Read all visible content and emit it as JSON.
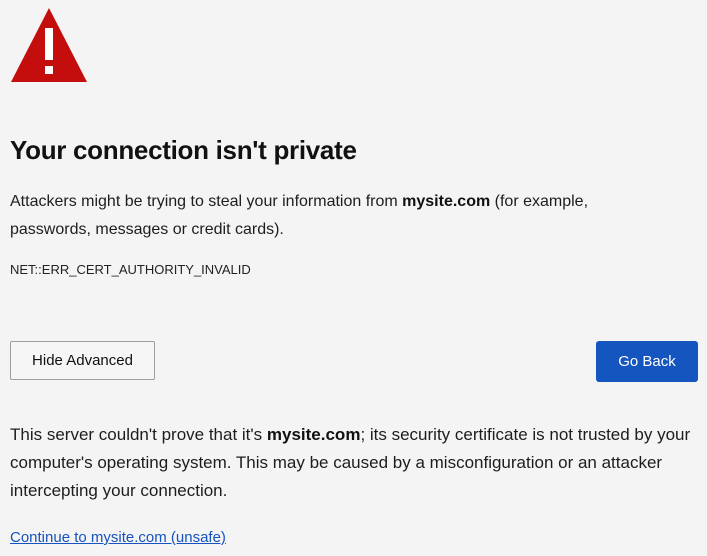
{
  "header": {
    "title": "Your connection isn't private"
  },
  "intro": {
    "before": "Attackers might be trying to steal your information from ",
    "site": "mysite.com",
    "after": " (for example, passwords, messages or credit cards)."
  },
  "error_code": "NET::ERR_CERT_AUTHORITY_INVALID",
  "buttons": {
    "hide_advanced": "Hide Advanced",
    "go_back": "Go Back"
  },
  "details": {
    "before": "This server couldn't prove that it's ",
    "site": "mysite.com",
    "after": "; its security certificate is not trusted by your computer's operating system. This may be caused by a misconfiguration or an attacker intercepting your connection."
  },
  "continue_link": "Continue to mysite.com (unsafe)",
  "icons": {
    "warning": "warning-triangle-icon"
  },
  "colors": {
    "background": "#f4f4f4",
    "warning_red": "#c40d0d",
    "primary_blue": "#1455c0",
    "link_blue": "#1553c0"
  }
}
